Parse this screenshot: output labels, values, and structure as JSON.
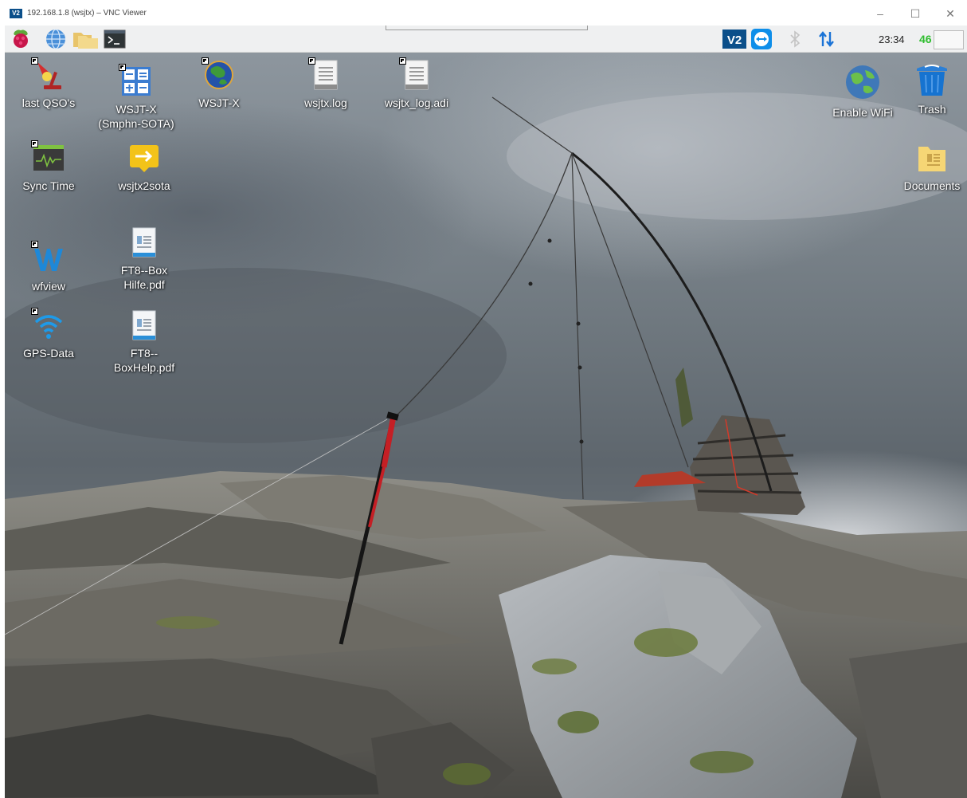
{
  "window": {
    "logo_text": "V2",
    "title": "192.168.1.8 (wsjtx) – VNC Viewer",
    "minimize_glyph": "–",
    "maximize_glyph": "☐",
    "close_glyph": "✕"
  },
  "taskbar": {
    "left_icons": [
      "raspberry-menu-icon",
      "web-browser-icon",
      "file-manager-icon",
      "terminal-icon"
    ],
    "tray_icons": [
      "vnc-server-icon",
      "teamviewer-icon",
      "bluetooth-icon",
      "network-arrows-icon"
    ],
    "clock": "23:34",
    "cpu_usage": "46"
  },
  "desktop": {
    "icons": [
      {
        "name": "last-qsos-icon",
        "label": "last QSO's",
        "glyph": "lamp"
      },
      {
        "name": "wsjtx-smphn-sota-icon",
        "label": "WSJT-X\n(Smphn-SOTA)",
        "glyph": "calculator"
      },
      {
        "name": "wsjtx-icon",
        "label": "WSJT-X",
        "glyph": "globe"
      },
      {
        "name": "wsjtx-log-icon",
        "label": "wsjtx.log",
        "glyph": "textfile"
      },
      {
        "name": "wsjtx-log-adi-icon",
        "label": "wsjtx_log.adi",
        "glyph": "textfile"
      },
      {
        "name": "sync-time-icon",
        "label": "Sync Time",
        "glyph": "monitor"
      },
      {
        "name": "wsjtx2sota-icon",
        "label": "wsjtx2sota",
        "glyph": "arrow"
      },
      {
        "name": "wfview-icon",
        "label": "wfview",
        "glyph": "w-logo"
      },
      {
        "name": "ft8-box-hilfe-icon",
        "label": "FT8--Box\nHilfe.pdf",
        "glyph": "pdf"
      },
      {
        "name": "gps-data-icon",
        "label": "GPS-Data",
        "glyph": "wifi"
      },
      {
        "name": "ft8-boxhelp-icon",
        "label": "FT8--\nBoxHelp.pdf",
        "glyph": "pdf"
      },
      {
        "name": "enable-wifi-icon",
        "label": "Enable WiFi",
        "glyph": "earth"
      },
      {
        "name": "trash-icon",
        "label": "Trash",
        "glyph": "trash"
      },
      {
        "name": "documents-icon",
        "label": "Documents",
        "glyph": "folder"
      }
    ]
  }
}
